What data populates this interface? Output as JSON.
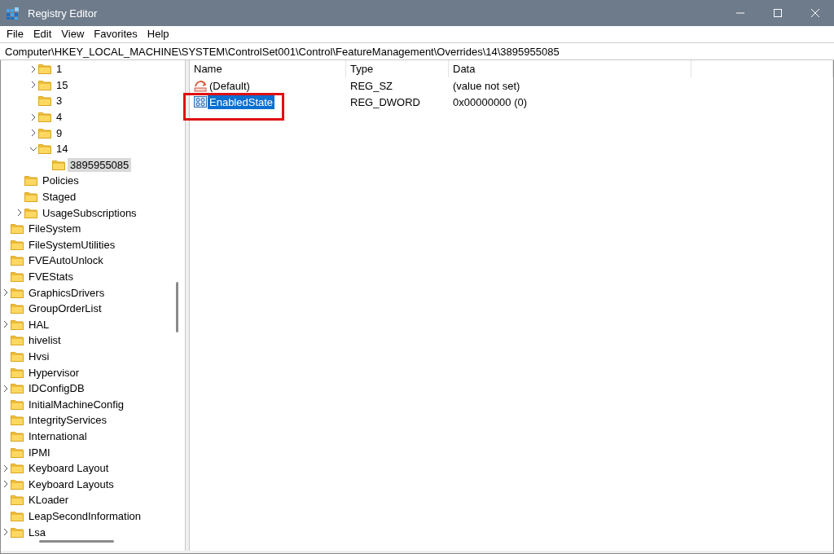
{
  "window": {
    "title": "Registry Editor"
  },
  "menu": [
    {
      "label": "File"
    },
    {
      "label": "Edit"
    },
    {
      "label": "View"
    },
    {
      "label": "Favorites"
    },
    {
      "label": "Help"
    }
  ],
  "address": "Computer\\HKEY_LOCAL_MACHINE\\SYSTEM\\ControlSet001\\Control\\FeatureManagement\\Overrides\\14\\3895955085",
  "tree": {
    "items": [
      {
        "children": [
          {
            "children": [
              {
                "label": "1",
                "expandable": true,
                "expanded": false,
                "selected": false
              },
              {
                "label": "15",
                "expandable": true,
                "expanded": false,
                "selected": false
              },
              {
                "label": "3",
                "expandable": false,
                "selected": false
              },
              {
                "label": "4",
                "expandable": true,
                "expanded": false,
                "selected": false
              },
              {
                "label": "9",
                "expandable": true,
                "expanded": false,
                "selected": false
              },
              {
                "label": "14",
                "expandable": true,
                "expanded": true,
                "selected": false,
                "children": [
                  {
                    "label": "3895955085",
                    "expandable": false,
                    "selected": true
                  }
                ]
              }
            ]
          },
          {
            "label": "Policies",
            "expandable": false,
            "selected": false
          },
          {
            "label": "Staged",
            "expandable": false,
            "selected": false
          },
          {
            "label": "UsageSubscriptions",
            "expandable": true,
            "expanded": false,
            "selected": false
          }
        ]
      },
      {
        "label": "FileSystem",
        "expandable": false,
        "selected": false
      },
      {
        "label": "FileSystemUtilities",
        "expandable": false,
        "selected": false
      },
      {
        "label": "FVEAutoUnlock",
        "expandable": false,
        "selected": false
      },
      {
        "label": "FVEStats",
        "expandable": false,
        "selected": false
      },
      {
        "label": "GraphicsDrivers",
        "expandable": true,
        "expanded": false,
        "selected": false
      },
      {
        "label": "GroupOrderList",
        "expandable": false,
        "selected": false
      },
      {
        "label": "HAL",
        "expandable": true,
        "expanded": false,
        "selected": false
      },
      {
        "label": "hivelist",
        "expandable": false,
        "selected": false
      },
      {
        "label": "Hvsi",
        "expandable": false,
        "selected": false
      },
      {
        "label": "Hypervisor",
        "expandable": false,
        "selected": false
      },
      {
        "label": "IDConfigDB",
        "expandable": true,
        "expanded": false,
        "selected": false
      },
      {
        "label": "InitialMachineConfig",
        "expandable": false,
        "selected": false
      },
      {
        "label": "IntegrityServices",
        "expandable": false,
        "selected": false
      },
      {
        "label": "International",
        "expandable": false,
        "selected": false
      },
      {
        "label": "IPMI",
        "expandable": false,
        "selected": false
      },
      {
        "label": "Keyboard Layout",
        "expandable": true,
        "expanded": false,
        "selected": false
      },
      {
        "label": "Keyboard Layouts",
        "expandable": true,
        "expanded": false,
        "selected": false
      },
      {
        "label": "KLoader",
        "expandable": false,
        "selected": false
      },
      {
        "label": "LeapSecondInformation",
        "expandable": false,
        "selected": false
      },
      {
        "label": "Lsa",
        "expandable": true,
        "expanded": false,
        "selected": false
      }
    ]
  },
  "values": {
    "columns": [
      "Name",
      "Type",
      "Data"
    ],
    "rows": [
      {
        "kind": "string",
        "name": "(Default)",
        "type": "REG_SZ",
        "data": "(value not set)",
        "selected": false,
        "outlined": false
      },
      {
        "kind": "binary",
        "name": "EnabledState",
        "type": "REG_DWORD",
        "data": "0x00000000 (0)",
        "selected": true,
        "outlined": true
      }
    ]
  }
}
